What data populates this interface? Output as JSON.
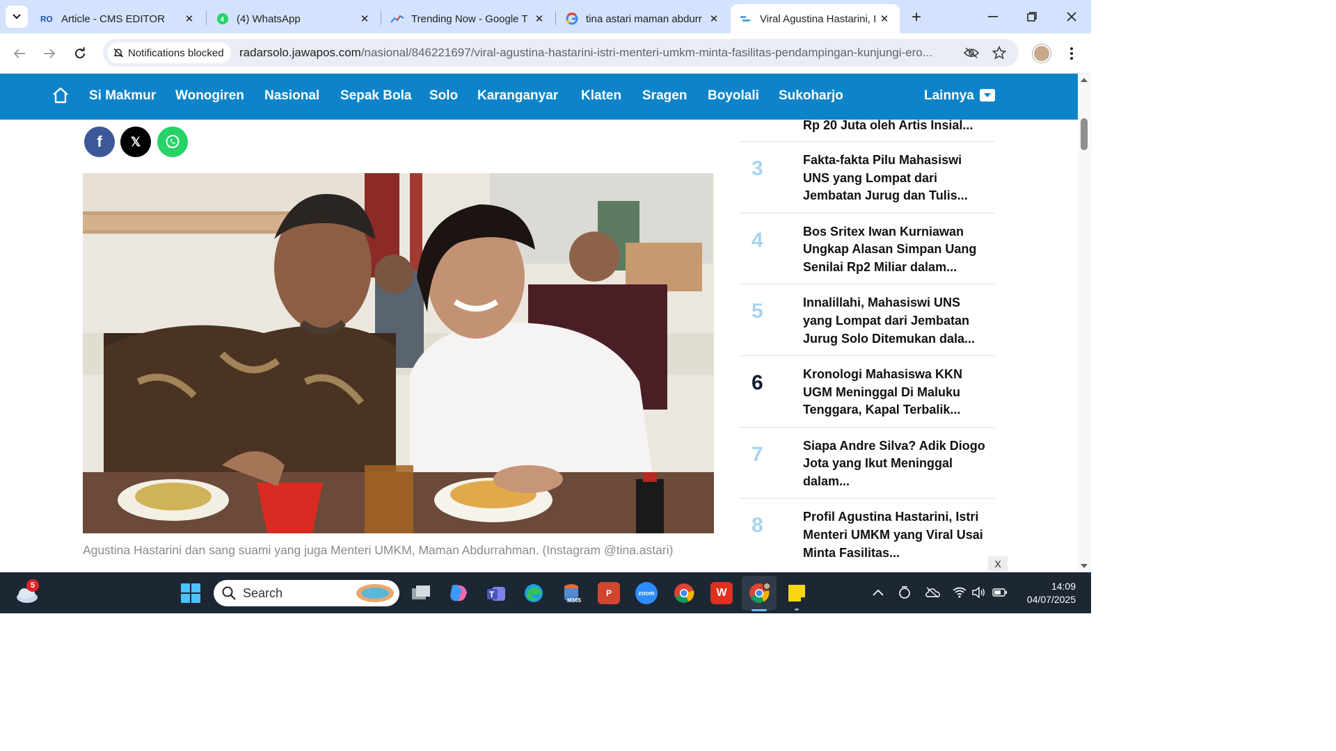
{
  "browser": {
    "tabs": [
      {
        "title": "Article - CMS EDITOR",
        "favicon": "cms-icon",
        "active": false
      },
      {
        "title": "(4) WhatsApp",
        "favicon": "whatsapp-icon",
        "active": false
      },
      {
        "title": "Trending Now - Google T",
        "favicon": "trends-icon",
        "active": false
      },
      {
        "title": "tina astari maman abdurr",
        "favicon": "google-icon",
        "active": false
      },
      {
        "title": "Viral Agustina Hastarini, I",
        "favicon": "radarsolo-icon",
        "active": true
      }
    ],
    "notifications_chip": "Notifications blocked",
    "url_host": "radarsolo.jawapos.com",
    "url_path": "/nasional/846221697/viral-agustina-hastarini-istri-menteri-umkm-minta-fasilitas-pendampingan-kunjungi-ero..."
  },
  "site_nav": {
    "items": [
      "Si Makmur",
      "Wonogiren",
      "Nasional",
      "Sepak Bola",
      "Solo",
      "Karanganyar",
      "Klaten",
      "Sragen",
      "Boyolali",
      "Sukoharjo"
    ],
    "more_label": "Lainnya"
  },
  "article": {
    "share": {
      "facebook": "f",
      "x": "𝕏",
      "whatsapp": "whatsapp-icon"
    },
    "caption": "Agustina Hastarini dan sang suami yang juga Menteri UMKM, Maman Abdurrahman. (Instagram @tina.astari)"
  },
  "sidebar": {
    "top_partial": "Rp 20 Juta oleh Artis Insial...",
    "items": [
      {
        "rank": "3",
        "title": "Fakta-fakta Pilu Mahasiswi UNS yang Lompat dari Jembatan Jurug dan Tulis..."
      },
      {
        "rank": "4",
        "title": "Bos Sritex Iwan Kurniawan Ungkap Alasan Simpan Uang Senilai Rp2 Miliar dalam..."
      },
      {
        "rank": "5",
        "title": "Innalillahi, Mahasiswi UNS yang Lompat dari Jembatan Jurug Solo Ditemukan dala..."
      },
      {
        "rank": "6",
        "title": "Kronologi Mahasiswa KKN UGM Meninggal Di Maluku Tenggara, Kapal Terbalik..."
      },
      {
        "rank": "7",
        "title": "Siapa Andre Silva? Adik Diogo Jota yang Ikut Meninggal dalam..."
      },
      {
        "rank": "8",
        "title": "Profil Agustina Hastarini, Istri Menteri UMKM yang Viral Usai Minta Fasilitas..."
      }
    ],
    "close_label": "X"
  },
  "taskbar": {
    "weather_badge": "5",
    "search_label": "Search",
    "zoom_label": "zoom",
    "m365_label": "M365",
    "time": "14:09",
    "date": "04/07/2025"
  },
  "colors": {
    "nav_blue": "#0d84c9",
    "tabstrip": "#d3e3fd",
    "rank_light": "#a9d3ef",
    "rank_dark": "#0e1b2a",
    "taskbar": "#1c2733"
  }
}
